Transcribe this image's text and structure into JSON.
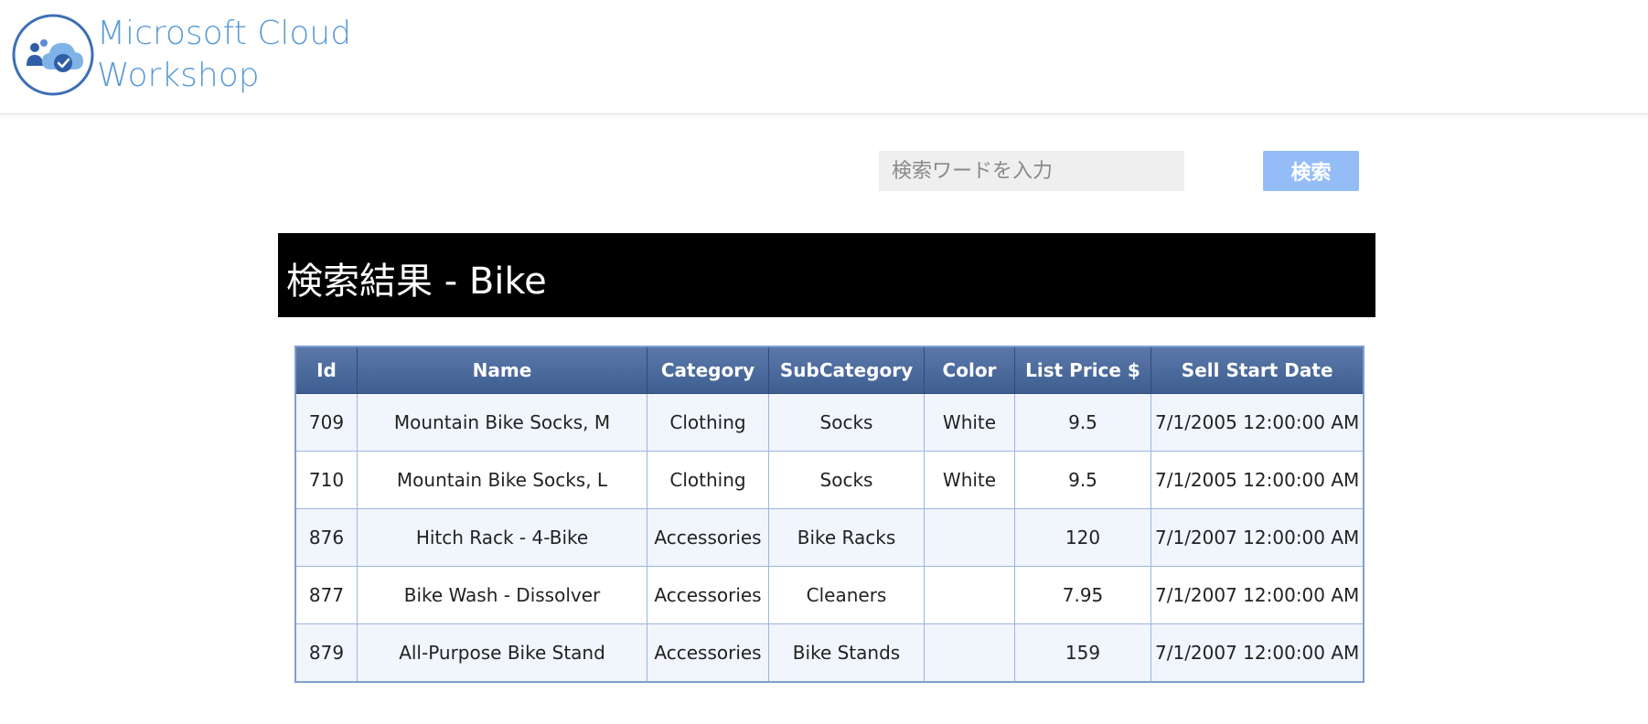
{
  "header": {
    "logo_line1": "Microsoft Cloud",
    "logo_line2": "Workshop",
    "brand_color": "#5b9bd5"
  },
  "search": {
    "placeholder": "検索ワードを入力",
    "value": "",
    "button_label": "検索",
    "button_color": "#94bdf8"
  },
  "results": {
    "title": "検索結果 - Bike",
    "columns": [
      "Id",
      "Name",
      "Category",
      "SubCategory",
      "Color",
      "List Price $",
      "Sell Start Date"
    ],
    "rows": [
      [
        "709",
        "Mountain Bike Socks, M",
        "Clothing",
        "Socks",
        "White",
        "9.5",
        "7/1/2005 12:00:00 AM"
      ],
      [
        "710",
        "Mountain Bike Socks, L",
        "Clothing",
        "Socks",
        "White",
        "9.5",
        "7/1/2005 12:00:00 AM"
      ],
      [
        "876",
        "Hitch Rack - 4-Bike",
        "Accessories",
        "Bike Racks",
        "",
        "120",
        "7/1/2007 12:00:00 AM"
      ],
      [
        "877",
        "Bike Wash - Dissolver",
        "Accessories",
        "Cleaners",
        "",
        "7.95",
        "7/1/2007 12:00:00 AM"
      ],
      [
        "879",
        "All-Purpose Bike Stand",
        "Accessories",
        "Bike Stands",
        "",
        "159",
        "7/1/2007 12:00:00 AM"
      ]
    ],
    "header_color": "#4a6a9e"
  }
}
